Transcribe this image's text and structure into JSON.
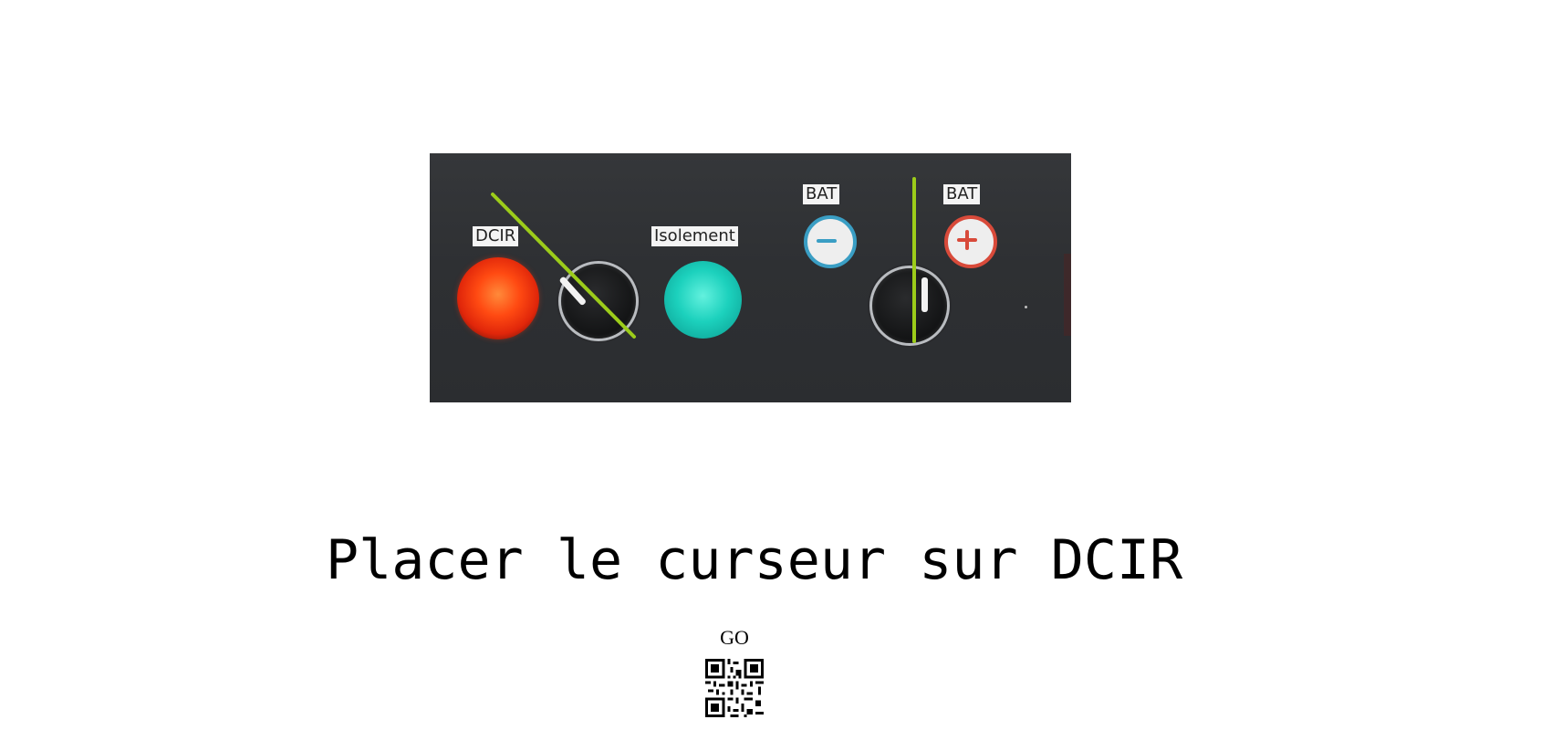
{
  "panel": {
    "labels": {
      "dcir": "DCIR",
      "isolement": "Isolement",
      "bat_minus": "BAT",
      "bat_plus": "BAT"
    },
    "colors": {
      "guide_line": "#9ccc1a",
      "red_lamp": "#ff4a12",
      "cyan_lamp": "#1cd1bd",
      "bat_minus_ring": "#3a9ec4",
      "bat_plus_ring": "#d84a3a"
    },
    "icons": {
      "bat_minus": "minus-icon",
      "bat_plus": "plus-icon"
    }
  },
  "instruction": {
    "text": "Placer le curseur sur DCIR"
  },
  "action": {
    "label": "GO",
    "qr_icon": "qr-code-icon"
  }
}
